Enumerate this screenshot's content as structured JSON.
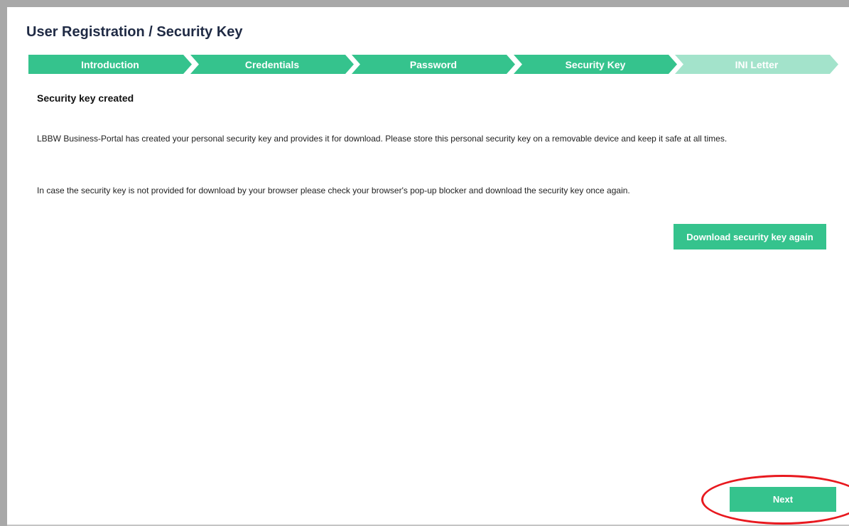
{
  "page": {
    "title": "User Registration / Security Key"
  },
  "stepper": {
    "steps": [
      {
        "label": "Introduction",
        "state": "completed"
      },
      {
        "label": "Credentials",
        "state": "completed"
      },
      {
        "label": "Password",
        "state": "completed"
      },
      {
        "label": "Security Key",
        "state": "current"
      },
      {
        "label": "INI Letter",
        "state": "upcoming"
      }
    ]
  },
  "content": {
    "heading": "Security key created",
    "paragraph_1": "LBBW Business-Portal has created your personal security key and provides it for download. Please store this personal security key on a removable device and keep it safe at all times.",
    "paragraph_2": "In case the security key is not provided for download by your browser please check your browser's pop-up blocker and download the security key once again."
  },
  "actions": {
    "download_label": "Download security key again",
    "next_label": "Next"
  },
  "colors": {
    "accent": "#35c38d",
    "accent_inactive": "#a3e3cb",
    "title": "#1f2a44",
    "highlight": "#e8191f"
  }
}
